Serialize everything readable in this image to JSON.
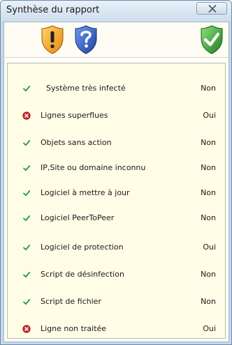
{
  "window": {
    "title": "Synthèse du rapport"
  },
  "shields": [
    {
      "icon": "warning-shield-icon",
      "color": "#f0a21c"
    },
    {
      "icon": "question-shield-icon",
      "color": "#2b5fc9"
    },
    {
      "icon": "check-shield-icon",
      "color": "#2e9b2e"
    }
  ],
  "report": {
    "rows": [
      {
        "label": "Système très infecté",
        "value": "Non",
        "status": "check"
      },
      {
        "label": "Lignes superflues",
        "value": "Oui",
        "status": "error"
      },
      {
        "label": "Objets sans action",
        "value": "Non",
        "status": "check"
      },
      {
        "label": "IP,Site ou domaine inconnu",
        "value": "Non",
        "status": "check"
      },
      {
        "label": "Logiciel à mettre à jour",
        "value": "Non",
        "status": "check"
      },
      {
        "label": "Logiciel PeerToPeer",
        "value": "Non",
        "status": "check"
      },
      {
        "label": "Logiciel de protection",
        "value": "Oui",
        "status": "check"
      },
      {
        "label": "Script de désinfection",
        "value": "Non",
        "status": "check"
      },
      {
        "label": "Script de fichier",
        "value": "Non",
        "status": "check"
      },
      {
        "label": "Ligne non traitée",
        "value": "Oui",
        "status": "error"
      }
    ]
  }
}
